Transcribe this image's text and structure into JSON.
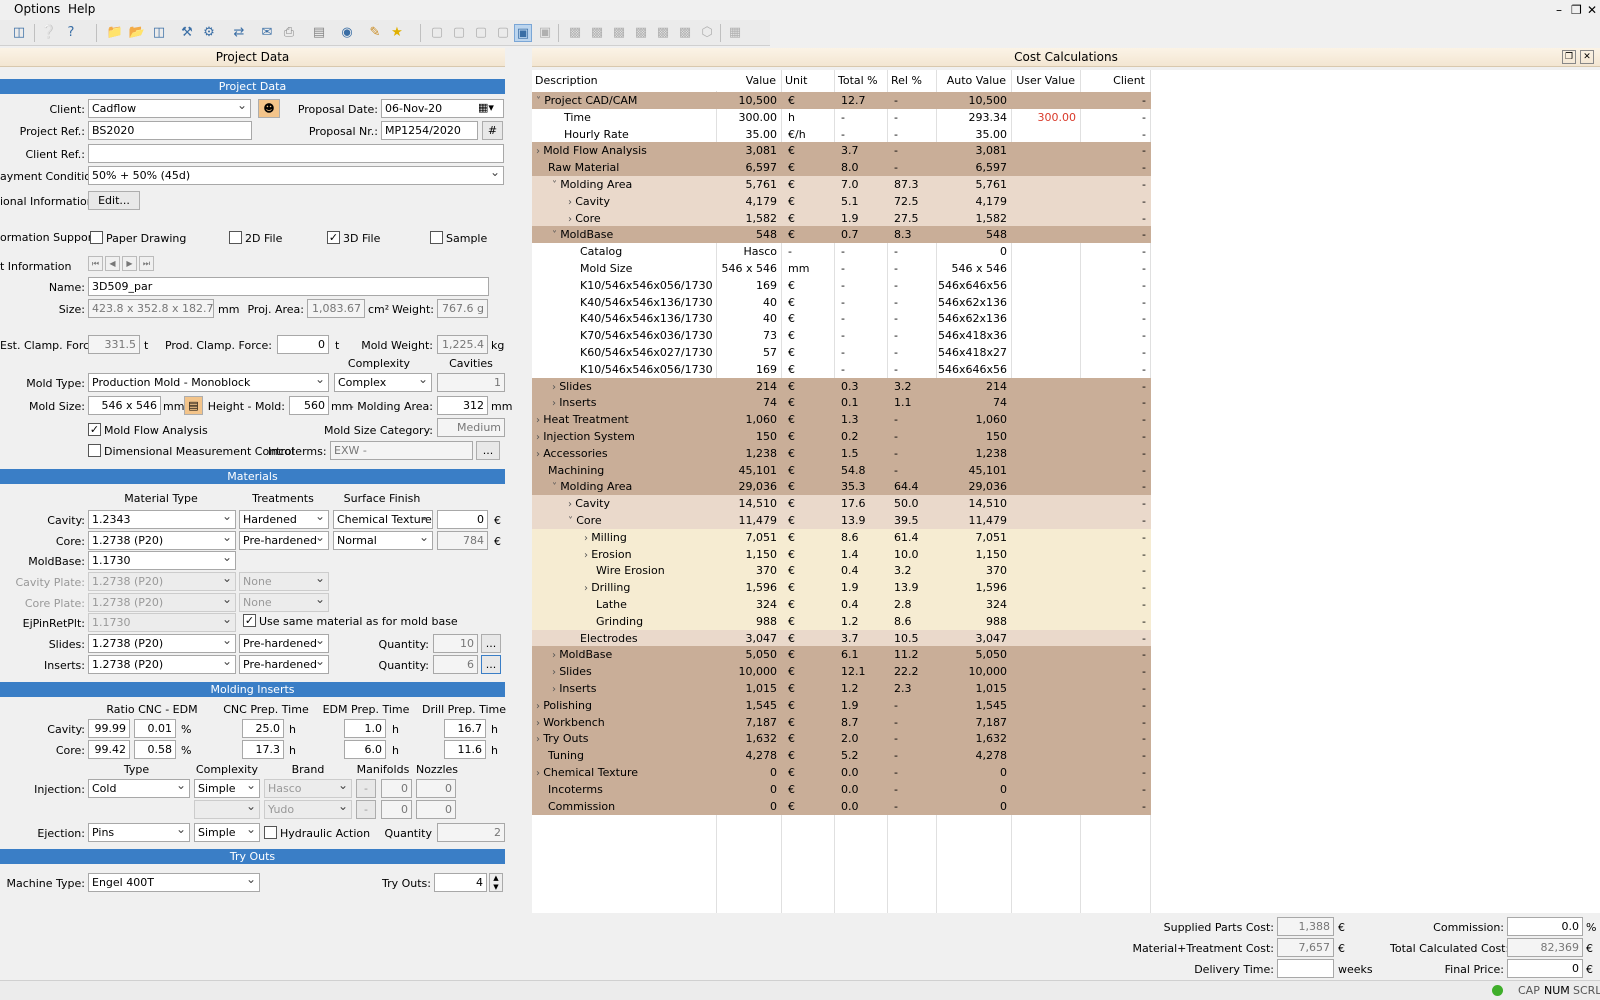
{
  "menu": {
    "options": "Options",
    "help": "Help"
  },
  "left_panel": {
    "title": "Project Data",
    "sections": {
      "project_data": "Project Data",
      "materials": "Materials",
      "molding_inserts": "Molding Inserts",
      "try_outs": "Try Outs"
    },
    "client": {
      "label": "Client:",
      "value": "Cadflow"
    },
    "proposal_date": {
      "label": "Proposal Date:",
      "value": "06-Nov-20"
    },
    "project_ref": {
      "label": "Project Ref.:",
      "value": "BS2020"
    },
    "proposal_nr": {
      "label": "Proposal Nr.:",
      "value": "MP1254/2020",
      "hash": "#"
    },
    "client_ref": {
      "label": "Client Ref.:",
      "value": ""
    },
    "payment": {
      "label": "ayment Conditions:",
      "value": "50% + 50% (45d)"
    },
    "additional": {
      "label": "ional Information:",
      "button": "Edit..."
    },
    "support": {
      "label": "ormation Support:",
      "paper": "Paper Drawing",
      "file2d": "2D File",
      "file3d": "3D File",
      "sample": "Sample"
    },
    "part_info": {
      "label": "t Information",
      "nav": [
        "⏮",
        "◀",
        "▶",
        "⏭"
      ]
    },
    "name": {
      "label": "Name:",
      "value": "3D509_par"
    },
    "size": {
      "label": "Size:",
      "value": "423.8 x 352.8 x 182.7",
      "unit": "mm"
    },
    "proj_area": {
      "label": "Proj. Area:",
      "value": "1,083.67",
      "unit": "cm²"
    },
    "weight": {
      "label": "Weight:",
      "value": "767.6 g"
    },
    "est_clamp": {
      "label": "Est. Clamp. Force:",
      "value": "331.5",
      "unit": "t"
    },
    "prod_clamp": {
      "label": "Prod. Clamp. Force:",
      "value": "0",
      "unit": "t"
    },
    "mold_weight": {
      "label": "Mold Weight:",
      "value": "1,225.4",
      "unit": "kg"
    },
    "complexity_hdr": "Complexity",
    "cavities_hdr": "Cavities",
    "mold_type": {
      "label": "Mold Type:",
      "value": "Production Mold - Monoblock",
      "complexity": "Complex",
      "cavities": "1"
    },
    "mold_size": {
      "label": "Mold Size:",
      "value": "546 x 546",
      "unit": "mm"
    },
    "height_mold": {
      "label": "Height - Mold:",
      "value": "560",
      "unit": "mm"
    },
    "molding_area": {
      "label": "- Molding Area:",
      "value": "312",
      "unit": "mm"
    },
    "mold_flow": {
      "label": "Mold Flow Analysis"
    },
    "mold_size_cat": {
      "label": "Mold Size Category:",
      "value": "Medium"
    },
    "dim_measure": {
      "label": "Dimensional Measurement Control"
    },
    "incoterms": {
      "label": "Incoterms:",
      "value": "EXW -",
      "button": "..."
    },
    "mat_hdr": {
      "type": "Material Type",
      "treat": "Treatments",
      "surf": "Surface Finish"
    },
    "cavity_mat": {
      "label": "Cavity:",
      "type": "1.2343",
      "treat": "Hardened",
      "surf": "Chemical Texture",
      "value": "0",
      "unit": "€"
    },
    "core_mat": {
      "label": "Core:",
      "type": "1.2738 (P20)",
      "treat": "Pre-hardened",
      "surf": "Normal",
      "value": "784",
      "unit": "€"
    },
    "moldbase_mat": {
      "label": "MoldBase:",
      "type": "1.1730"
    },
    "cavity_plate": {
      "label": "Cavity Plate:",
      "type": "1.2738 (P20)",
      "treat": "None"
    },
    "core_plate": {
      "label": "Core Plate:",
      "type": "1.2738 (P20)",
      "treat": "None"
    },
    "ejpin": {
      "label": "EjPinRetPlt:",
      "type": "1.1730",
      "same": "Use same material as for mold base"
    },
    "slides_mat": {
      "label": "Slides:",
      "type": "1.2738 (P20)",
      "treat": "Pre-hardened",
      "qty_label": "Quantity:",
      "qty": "10",
      "button": "..."
    },
    "inserts_mat": {
      "label": "Inserts:",
      "type": "1.2738 (P20)",
      "treat": "Pre-hardened",
      "qty_label": "Quantity:",
      "qty": "6",
      "button": "..."
    },
    "mi_hdr": {
      "ratio": "Ratio CNC - EDM",
      "cnc": "CNC Prep. Time",
      "edm": "EDM Prep. Time",
      "drill": "Drill Prep. Time"
    },
    "mi_cavity": {
      "label": "Cavity:",
      "cnc_r": "99.99",
      "edm_r": "0.01",
      "pct": "%",
      "cnc": "25.0",
      "edm": "1.0",
      "drill": "16.7",
      "h": "h"
    },
    "mi_core": {
      "label": "Core:",
      "cnc_r": "99.42",
      "edm_r": "0.58",
      "pct": "%",
      "cnc": "17.3",
      "edm": "6.0",
      "drill": "11.6",
      "h": "h"
    },
    "inj_hdr": {
      "type": "Type",
      "complexity": "Complexity",
      "brand": "Brand",
      "manifolds": "Manifolds",
      "nozzles": "Nozzles"
    },
    "injection": {
      "label": "Injection:",
      "type": "Cold",
      "complexity": "Simple",
      "brand1": "Hasco",
      "brand2": "Yudo",
      "m1": "0",
      "n1": "0",
      "m2": "0",
      "n2": "0",
      "dash": "-"
    },
    "ejection": {
      "label": "Ejection:",
      "type": "Pins",
      "complexity": "Simple",
      "hydraulic": "Hydraulic Action",
      "qty_label": "Quantity",
      "qty": "2"
    },
    "machine": {
      "label": "Machine Type:",
      "value": "Engel 400T"
    },
    "tryouts": {
      "label": "Try Outs:",
      "value": "4"
    }
  },
  "right_panel": {
    "title": "Cost Calculations",
    "columns": [
      "Description",
      "Value",
      "Unit",
      "Total %",
      "Rel %",
      "Auto Value",
      "User Value",
      "Client Value"
    ],
    "rows": [
      {
        "lvl": 0,
        "exp": "v",
        "desc": "Project CAD/CAM",
        "value": "10,500",
        "unit": "€",
        "tot": "12.7",
        "rel": "-",
        "auto": "10,500",
        "user": "",
        "client": "-",
        "bg": "bg1"
      },
      {
        "lvl": 1,
        "exp": "",
        "desc": "Time",
        "value": "300.00",
        "unit": "h",
        "tot": "-",
        "rel": "-",
        "auto": "293.34",
        "user": "300.00",
        "client": "-",
        "bg": ""
      },
      {
        "lvl": 1,
        "exp": "",
        "desc": "Hourly Rate",
        "value": "35.00",
        "unit": "€/h",
        "tot": "-",
        "rel": "-",
        "auto": "35.00",
        "user": "",
        "client": "-",
        "bg": ""
      },
      {
        "lvl": 0,
        "exp": ">",
        "desc": "Mold Flow Analysis",
        "value": "3,081",
        "unit": "€",
        "tot": "3.7",
        "rel": "-",
        "auto": "3,081",
        "user": "",
        "client": "-",
        "bg": "bg1"
      },
      {
        "lvl": 0,
        "exp": "",
        "desc": "Raw Material",
        "value": "6,597",
        "unit": "€",
        "tot": "8.0",
        "rel": "-",
        "auto": "6,597",
        "user": "",
        "client": "-",
        "bg": "bg1"
      },
      {
        "lvl": 1,
        "exp": "v",
        "desc": "Molding Area",
        "value": "5,761",
        "unit": "€",
        "tot": "7.0",
        "rel": "87.3",
        "auto": "5,761",
        "user": "",
        "client": "-",
        "bg": "bg2"
      },
      {
        "lvl": 2,
        "exp": ">",
        "desc": "Cavity",
        "value": "4,179",
        "unit": "€",
        "tot": "5.1",
        "rel": "72.5",
        "auto": "4,179",
        "user": "",
        "client": "-",
        "bg": "bg2"
      },
      {
        "lvl": 2,
        "exp": ">",
        "desc": "Core",
        "value": "1,582",
        "unit": "€",
        "tot": "1.9",
        "rel": "27.5",
        "auto": "1,582",
        "user": "",
        "client": "-",
        "bg": "bg2"
      },
      {
        "lvl": 1,
        "exp": "v",
        "desc": "MoldBase",
        "value": "548",
        "unit": "€",
        "tot": "0.7",
        "rel": "8.3",
        "auto": "548",
        "user": "",
        "client": "-",
        "bg": "bg1"
      },
      {
        "lvl": 2,
        "exp": "",
        "desc": "Catalog",
        "value": "Hasco",
        "unit": "-",
        "tot": "-",
        "rel": "-",
        "auto": "0",
        "user": "",
        "client": "-",
        "bg": ""
      },
      {
        "lvl": 2,
        "exp": "",
        "desc": "Mold Size",
        "value": "546 x 546",
        "unit": "mm",
        "tot": "-",
        "rel": "-",
        "auto": "546 x 546",
        "user": "",
        "client": "-",
        "bg": ""
      },
      {
        "lvl": 2,
        "exp": "",
        "desc": "K10/546x546x056/1730",
        "value": "169",
        "unit": "€",
        "tot": "-",
        "rel": "-",
        "auto": "546x646x56",
        "user": "",
        "client": "-",
        "bg": ""
      },
      {
        "lvl": 2,
        "exp": "",
        "desc": "K40/546x546x136/1730",
        "value": "40",
        "unit": "€",
        "tot": "-",
        "rel": "-",
        "auto": "546x62x136",
        "user": "",
        "client": "-",
        "bg": ""
      },
      {
        "lvl": 2,
        "exp": "",
        "desc": "K40/546x546x136/1730",
        "value": "40",
        "unit": "€",
        "tot": "-",
        "rel": "-",
        "auto": "546x62x136",
        "user": "",
        "client": "-",
        "bg": ""
      },
      {
        "lvl": 2,
        "exp": "",
        "desc": "K70/546x546x036/1730",
        "value": "73",
        "unit": "€",
        "tot": "-",
        "rel": "-",
        "auto": "546x418x36",
        "user": "",
        "client": "-",
        "bg": ""
      },
      {
        "lvl": 2,
        "exp": "",
        "desc": "K60/546x546x027/1730",
        "value": "57",
        "unit": "€",
        "tot": "-",
        "rel": "-",
        "auto": "546x418x27",
        "user": "",
        "client": "-",
        "bg": ""
      },
      {
        "lvl": 2,
        "exp": "",
        "desc": "K10/546x546x056/1730",
        "value": "169",
        "unit": "€",
        "tot": "-",
        "rel": "-",
        "auto": "546x646x56",
        "user": "",
        "client": "-",
        "bg": ""
      },
      {
        "lvl": 1,
        "exp": ">",
        "desc": "Slides",
        "value": "214",
        "unit": "€",
        "tot": "0.3",
        "rel": "3.2",
        "auto": "214",
        "user": "",
        "client": "-",
        "bg": "bg1"
      },
      {
        "lvl": 1,
        "exp": ">",
        "desc": "Inserts",
        "value": "74",
        "unit": "€",
        "tot": "0.1",
        "rel": "1.1",
        "auto": "74",
        "user": "",
        "client": "-",
        "bg": "bg1"
      },
      {
        "lvl": 0,
        "exp": ">",
        "desc": "Heat Treatment",
        "value": "1,060",
        "unit": "€",
        "tot": "1.3",
        "rel": "-",
        "auto": "1,060",
        "user": "",
        "client": "-",
        "bg": "bg1"
      },
      {
        "lvl": 0,
        "exp": ">",
        "desc": "Injection System",
        "value": "150",
        "unit": "€",
        "tot": "0.2",
        "rel": "-",
        "auto": "150",
        "user": "",
        "client": "-",
        "bg": "bg1"
      },
      {
        "lvl": 0,
        "exp": ">",
        "desc": "Accessories",
        "value": "1,238",
        "unit": "€",
        "tot": "1.5",
        "rel": "-",
        "auto": "1,238",
        "user": "",
        "client": "-",
        "bg": "bg1"
      },
      {
        "lvl": 0,
        "exp": "",
        "desc": "Machining",
        "value": "45,101",
        "unit": "€",
        "tot": "54.8",
        "rel": "-",
        "auto": "45,101",
        "user": "",
        "client": "-",
        "bg": "bg1"
      },
      {
        "lvl": 1,
        "exp": "v",
        "desc": "Molding Area",
        "value": "29,036",
        "unit": "€",
        "tot": "35.3",
        "rel": "64.4",
        "auto": "29,036",
        "user": "",
        "client": "-",
        "bg": "bg1"
      },
      {
        "lvl": 2,
        "exp": ">",
        "desc": "Cavity",
        "value": "14,510",
        "unit": "€",
        "tot": "17.6",
        "rel": "50.0",
        "auto": "14,510",
        "user": "",
        "client": "-",
        "bg": "bg2"
      },
      {
        "lvl": 2,
        "exp": "v",
        "desc": "Core",
        "value": "11,479",
        "unit": "€",
        "tot": "13.9",
        "rel": "39.5",
        "auto": "11,479",
        "user": "",
        "client": "-",
        "bg": "bg2"
      },
      {
        "lvl": 3,
        "exp": ">",
        "desc": "Milling",
        "value": "7,051",
        "unit": "€",
        "tot": "8.6",
        "rel": "61.4",
        "auto": "7,051",
        "user": "",
        "client": "-",
        "bg": "bg3"
      },
      {
        "lvl": 3,
        "exp": ">",
        "desc": "Erosion",
        "value": "1,150",
        "unit": "€",
        "tot": "1.4",
        "rel": "10.0",
        "auto": "1,150",
        "user": "",
        "client": "-",
        "bg": "bg3"
      },
      {
        "lvl": 3,
        "exp": "",
        "desc": "Wire Erosion",
        "value": "370",
        "unit": "€",
        "tot": "0.4",
        "rel": "3.2",
        "auto": "370",
        "user": "",
        "client": "-",
        "bg": "bg3"
      },
      {
        "lvl": 3,
        "exp": ">",
        "desc": "Drilling",
        "value": "1,596",
        "unit": "€",
        "tot": "1.9",
        "rel": "13.9",
        "auto": "1,596",
        "user": "",
        "client": "-",
        "bg": "bg3"
      },
      {
        "lvl": 3,
        "exp": "",
        "desc": "Lathe",
        "value": "324",
        "unit": "€",
        "tot": "0.4",
        "rel": "2.8",
        "auto": "324",
        "user": "",
        "client": "-",
        "bg": "bg3"
      },
      {
        "lvl": 3,
        "exp": "",
        "desc": "Grinding",
        "value": "988",
        "unit": "€",
        "tot": "1.2",
        "rel": "8.6",
        "auto": "988",
        "user": "",
        "client": "-",
        "bg": "bg3"
      },
      {
        "lvl": 2,
        "exp": "",
        "desc": "Electrodes",
        "value": "3,047",
        "unit": "€",
        "tot": "3.7",
        "rel": "10.5",
        "auto": "3,047",
        "user": "",
        "client": "-",
        "bg": "bg2"
      },
      {
        "lvl": 1,
        "exp": ">",
        "desc": "MoldBase",
        "value": "5,050",
        "unit": "€",
        "tot": "6.1",
        "rel": "11.2",
        "auto": "5,050",
        "user": "",
        "client": "-",
        "bg": "bg1"
      },
      {
        "lvl": 1,
        "exp": ">",
        "desc": "Slides",
        "value": "10,000",
        "unit": "€",
        "tot": "12.1",
        "rel": "22.2",
        "auto": "10,000",
        "user": "",
        "client": "-",
        "bg": "bg1"
      },
      {
        "lvl": 1,
        "exp": ">",
        "desc": "Inserts",
        "value": "1,015",
        "unit": "€",
        "tot": "1.2",
        "rel": "2.3",
        "auto": "1,015",
        "user": "",
        "client": "-",
        "bg": "bg1"
      },
      {
        "lvl": 0,
        "exp": ">",
        "desc": "Polishing",
        "value": "1,545",
        "unit": "€",
        "tot": "1.9",
        "rel": "-",
        "auto": "1,545",
        "user": "",
        "client": "-",
        "bg": "bg1"
      },
      {
        "lvl": 0,
        "exp": ">",
        "desc": "Workbench",
        "value": "7,187",
        "unit": "€",
        "tot": "8.7",
        "rel": "-",
        "auto": "7,187",
        "user": "",
        "client": "-",
        "bg": "bg1"
      },
      {
        "lvl": 0,
        "exp": ">",
        "desc": "Try Outs",
        "value": "1,632",
        "unit": "€",
        "tot": "2.0",
        "rel": "-",
        "auto": "1,632",
        "user": "",
        "client": "-",
        "bg": "bg1"
      },
      {
        "lvl": 0,
        "exp": "",
        "desc": "Tuning",
        "value": "4,278",
        "unit": "€",
        "tot": "5.2",
        "rel": "-",
        "auto": "4,278",
        "user": "",
        "client": "-",
        "bg": "bg1"
      },
      {
        "lvl": 0,
        "exp": ">",
        "desc": "Chemical Texture",
        "value": "0",
        "unit": "€",
        "tot": "0.0",
        "rel": "-",
        "auto": "0",
        "user": "",
        "client": "-",
        "bg": "bg1"
      },
      {
        "lvl": 0,
        "exp": "",
        "desc": "Incoterms",
        "value": "0",
        "unit": "€",
        "tot": "0.0",
        "rel": "-",
        "auto": "0",
        "user": "",
        "client": "-",
        "bg": "bg1"
      },
      {
        "lvl": 0,
        "exp": "",
        "desc": "Commission",
        "value": "0",
        "unit": "€",
        "tot": "0.0",
        "rel": "-",
        "auto": "0",
        "user": "",
        "client": "-",
        "bg": "bg1"
      }
    ]
  },
  "footer": {
    "supplied": {
      "label": "Supplied Parts Cost:",
      "value": "1,388",
      "unit": "€"
    },
    "material": {
      "label": "Material+Treatment Cost:",
      "value": "7,657",
      "unit": "€"
    },
    "delivery": {
      "label": "Delivery Time:",
      "value": "",
      "unit": "weeks"
    },
    "commission": {
      "label": "Commission:",
      "value": "0.0",
      "unit": "%"
    },
    "total": {
      "label": "Total Calculated Cost:",
      "value": "82,369",
      "unit": "€"
    },
    "final": {
      "label": "Final Price:",
      "value": "0",
      "unit": "€"
    }
  },
  "status": {
    "cap": "CAP",
    "num": "NUM",
    "scrl": "SCRL"
  },
  "colors": {
    "section": "#3a7ec6",
    "row_l0": "#c9ae98",
    "row_l1": "#ead9cb",
    "row_l2": "#f6ecd2",
    "user_value": "#d93a2b"
  }
}
